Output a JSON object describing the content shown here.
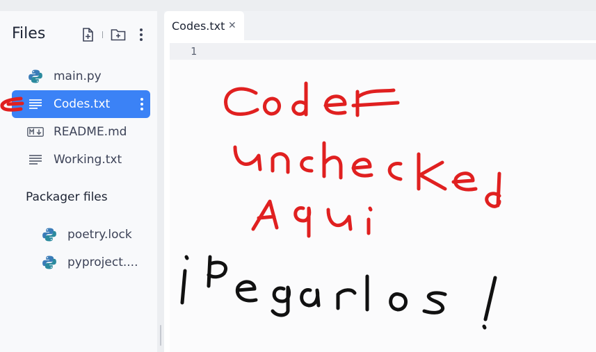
{
  "files_panel": {
    "title": "Files",
    "files": [
      {
        "name": "main.py",
        "icon": "python-icon"
      },
      {
        "name": "Codes.txt",
        "icon": "text-file-icon",
        "active": true
      },
      {
        "name": "README.md",
        "icon": "markdown-icon"
      },
      {
        "name": "Working.txt",
        "icon": "text-file-icon"
      }
    ],
    "packager_title": "Packager files",
    "packager_files": [
      {
        "name": "poetry.lock",
        "icon": "python-icon"
      },
      {
        "name": "pyproject....",
        "icon": "python-icon"
      }
    ]
  },
  "editor": {
    "tab_label": "Codes.txt",
    "line_numbers": [
      "1"
    ]
  },
  "handwriting": {
    "red_lines": [
      "Codes",
      "unchecked",
      "Aqui"
    ],
    "black_line": "¡Pegarlos!"
  },
  "colors": {
    "active_file_bg": "#3b82f6",
    "annotation_red": "#e02020",
    "annotation_black": "#111111"
  }
}
